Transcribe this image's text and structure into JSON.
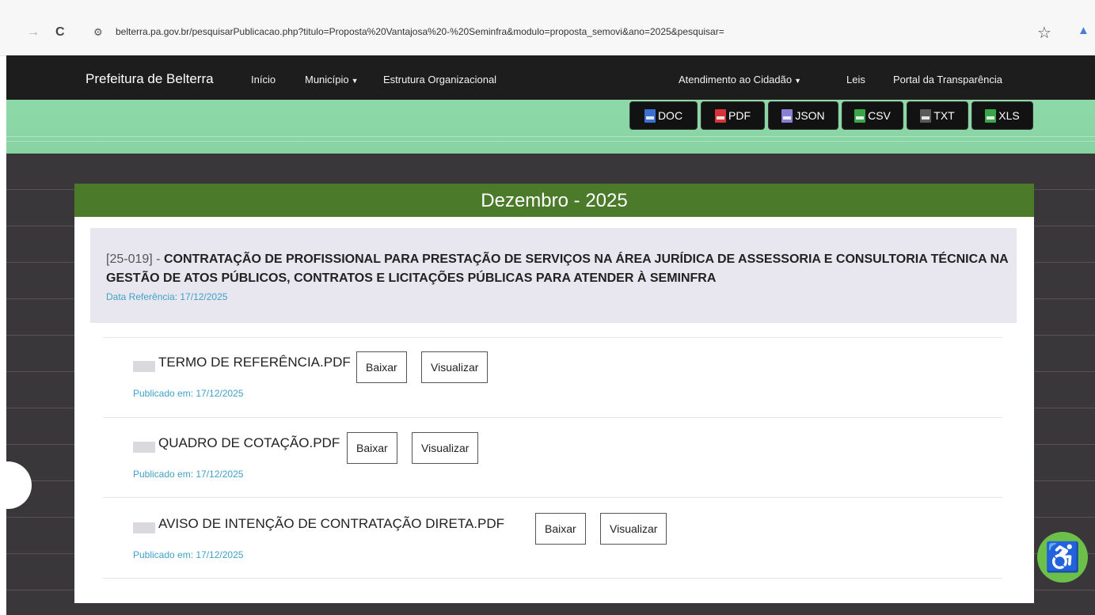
{
  "browser": {
    "url": "belterra.pa.gov.br/pesquisarPublicacao.php?titulo=Proposta%20Vantajosa%20-%20Seminfra&modulo=proposta_semovi&ano=2025&pesquisar="
  },
  "navbar": {
    "brand": "Prefeitura de Belterra",
    "links": [
      "Início",
      "Município",
      "Estrutura Organizacional",
      "Atendimento ao Cidadão",
      "Leis",
      "Portal da Transparência"
    ]
  },
  "exports": [
    {
      "label": "DOC",
      "color": "#3b6fd1"
    },
    {
      "label": "PDF",
      "color": "#d9333a"
    },
    {
      "label": "JSON",
      "color": "#8a7fd6"
    },
    {
      "label": "CSV",
      "color": "#3aa64a"
    },
    {
      "label": "TXT",
      "color": "#5a5a5a"
    },
    {
      "label": "XLS",
      "color": "#3aa64a"
    }
  ],
  "section": {
    "heading": "Dezembro - 2025"
  },
  "publication": {
    "code": "[25-019] - ",
    "title": "CONTRATAÇÃO DE PROFISSIONAL PARA PRESTAÇÃO DE SERVIÇOS NA ÁREA JURÍDICA DE ASSESSORIA E CONSULTORIA TÉCNICA NA GESTÃO DE ATOS PÚBLICOS, CONTRATOS E LICITAÇÕES PÚBLICAS PARA ATENDER À SEMINFRA",
    "date_label": "Data Referência: 17/12/2025"
  },
  "documents": [
    {
      "name": "TERMO DE REFERÊNCIA.PDF",
      "download": "Baixar",
      "view": "Visualizar",
      "published": "Publicado em: 17/12/2025"
    },
    {
      "name": "QUADRO DE COTAÇÃO.PDF",
      "download": "Baixar",
      "view": "Visualizar",
      "published": "Publicado em: 17/12/2025"
    },
    {
      "name": "AVISO DE INTENÇÃO DE CONTRATAÇÃO DIRETA.PDF",
      "download": "Baixar",
      "view": "Visualizar",
      "published": "Publicado em: 17/12/2025"
    }
  ],
  "accessibility_icon": "wheelchair-icon"
}
